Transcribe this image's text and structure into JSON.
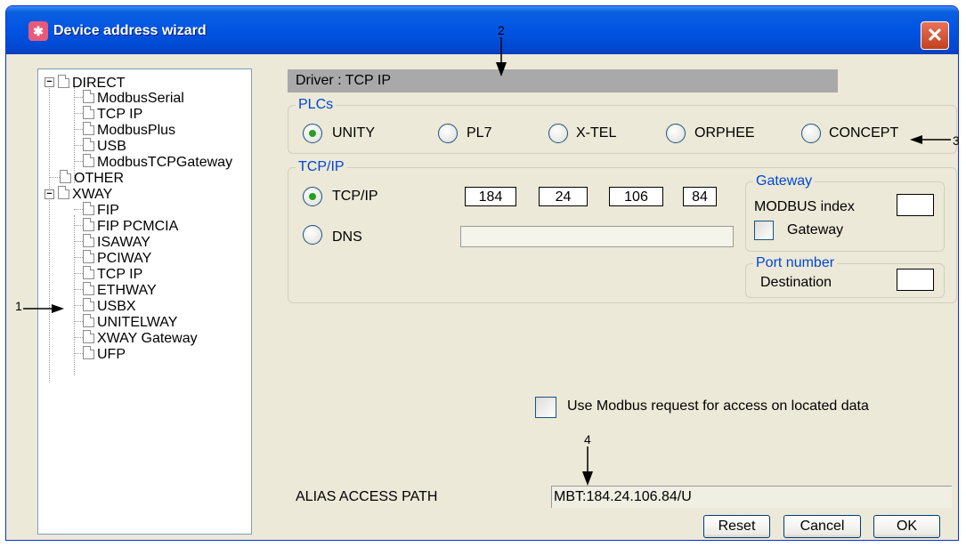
{
  "window": {
    "title": "Device address wizard",
    "close_label": "✕"
  },
  "tree": {
    "items": [
      {
        "label": "DIRECT",
        "level": 0
      },
      {
        "label": "ModbusSerial",
        "level": 1
      },
      {
        "label": "TCP IP",
        "level": 1
      },
      {
        "label": "ModbusPlus",
        "level": 1
      },
      {
        "label": "USB",
        "level": 1
      },
      {
        "label": "ModbusTCPGateway",
        "level": 1
      },
      {
        "label": "OTHER",
        "level": 0
      },
      {
        "label": "XWAY",
        "level": 0
      },
      {
        "label": "FIP",
        "level": 1
      },
      {
        "label": "FIP PCMCIA",
        "level": 1
      },
      {
        "label": "ISAWAY",
        "level": 1
      },
      {
        "label": "PCIWAY",
        "level": 1
      },
      {
        "label": "TCP IP",
        "level": 1
      },
      {
        "label": "ETHWAY",
        "level": 1
      },
      {
        "label": "USBX",
        "level": 1
      },
      {
        "label": "UNITELWAY",
        "level": 1
      },
      {
        "label": "XWAY Gateway",
        "level": 1
      },
      {
        "label": "UFP",
        "level": 1
      }
    ]
  },
  "driver_label": "Driver : TCP IP",
  "plcs": {
    "legend": "PLCs",
    "options": [
      "UNITY",
      "PL7",
      "X-TEL",
      "ORPHEE",
      "CONCEPT"
    ],
    "selected": "UNITY"
  },
  "tcpip": {
    "legend": "TCP/IP",
    "opt_tcpip": "TCP/IP",
    "opt_dns": "DNS",
    "ip": [
      "184",
      "24",
      "106",
      "84"
    ]
  },
  "gateway": {
    "legend": "Gateway",
    "modbus_index_label": "MODBUS index",
    "gateway_checkbox_label": "Gateway"
  },
  "port": {
    "legend": "Port number",
    "destination_label": "Destination"
  },
  "modbus_request_label": "Use Modbus request for access on located data",
  "alias": {
    "label": "ALIAS ACCESS PATH",
    "value": "MBT:184.24.106.84/U"
  },
  "buttons": {
    "reset": "Reset",
    "cancel": "Cancel",
    "ok": "OK"
  },
  "callouts": {
    "c1": "1",
    "c2": "2",
    "c3": "3",
    "c4": "4"
  }
}
